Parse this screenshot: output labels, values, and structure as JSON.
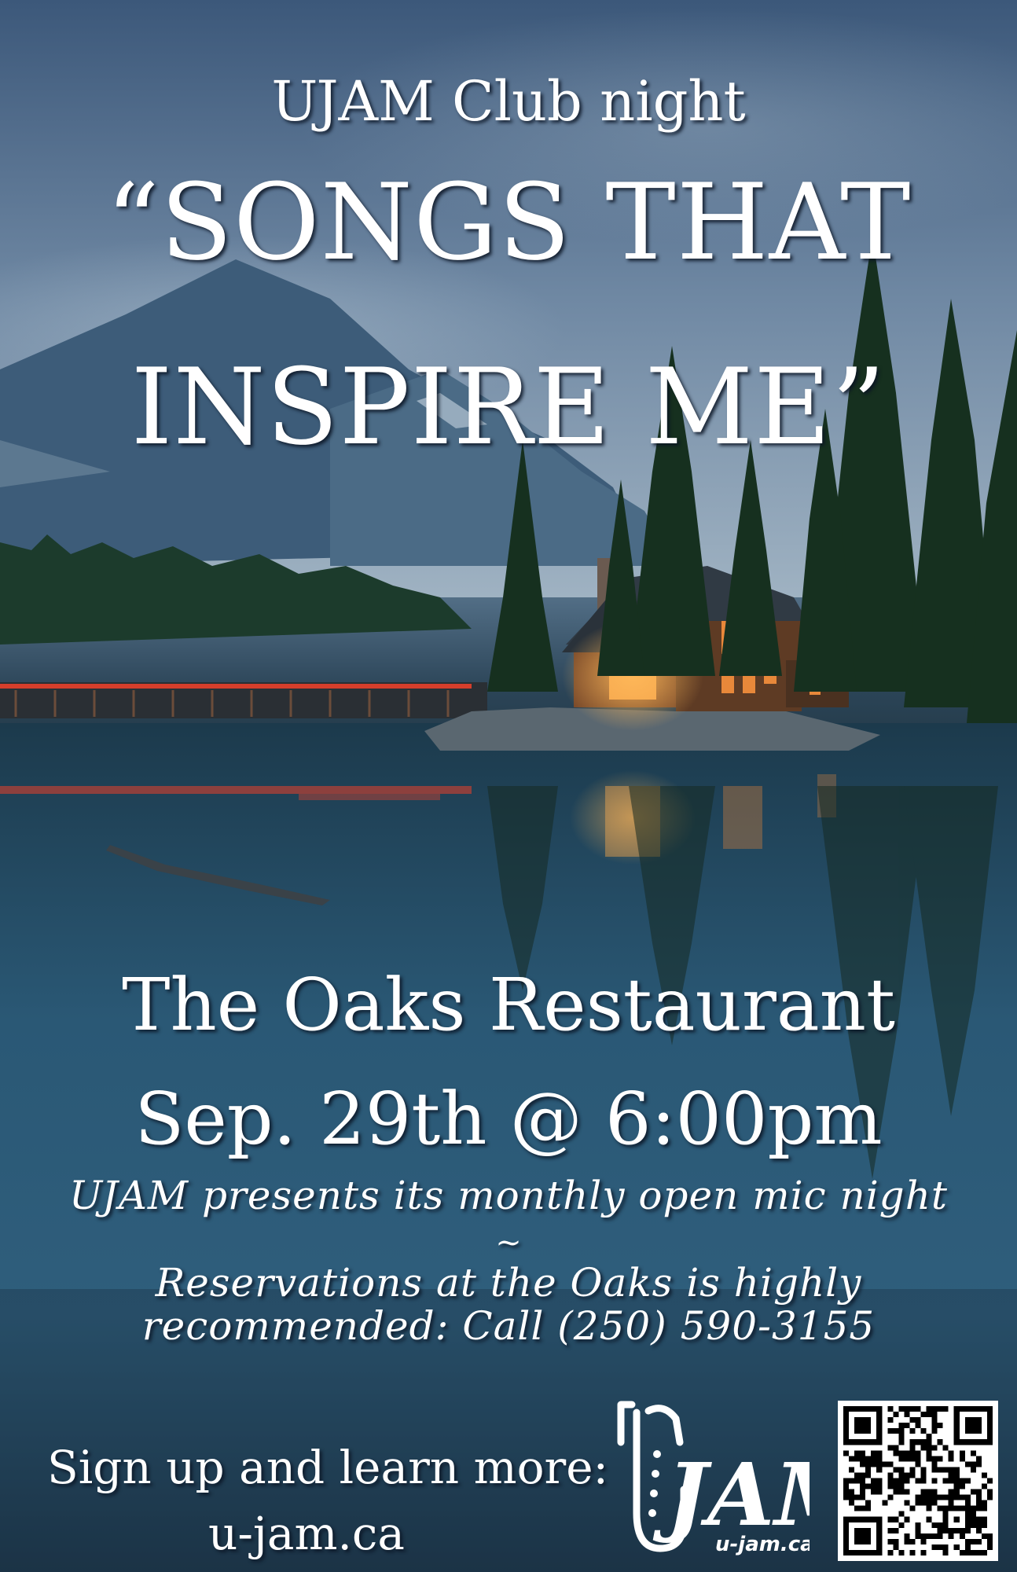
{
  "poster": {
    "club_night": "UJAM Club night",
    "title_line_1": "“SONGS THAT",
    "title_line_2": "INSPIRE ME”",
    "venue": "The Oaks Restaurant",
    "datetime": "Sep. 29th @ 6:00pm",
    "presents": "UJAM presents its monthly open mic night",
    "separator": "~",
    "reservation_line_1": "Reservations at the Oaks is highly",
    "reservation_line_2": "recommended: Call (250) 590-3155",
    "signup_label": "Sign up and learn more:",
    "website": "u-jam.ca"
  },
  "logo": {
    "text": "JAM",
    "tagline": "u-jam.ca",
    "icon": "saxophone-icon"
  },
  "qr": {
    "icon": "qr-code-icon"
  },
  "colors": {
    "text": "#ffffff",
    "lodge_glow": "#f2a24a",
    "bridge_lights": "#e8402a"
  }
}
